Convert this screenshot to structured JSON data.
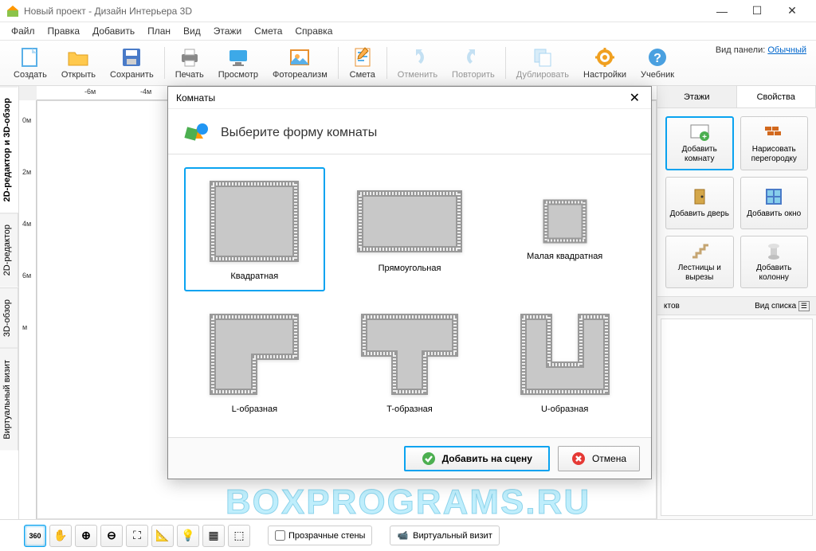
{
  "window": {
    "title": "Новый проект - Дизайн Интерьера 3D"
  },
  "menu": [
    "Файл",
    "Правка",
    "Добавить",
    "План",
    "Вид",
    "Этажи",
    "Смета",
    "Справка"
  ],
  "toolbar": {
    "create": "Создать",
    "open": "Открыть",
    "save": "Сохранить",
    "print": "Печать",
    "preview": "Просмотр",
    "photoreal": "Фотореализм",
    "estimate": "Смета",
    "undo": "Отменить",
    "redo": "Повторить",
    "duplicate": "Дублировать",
    "settings": "Настройки",
    "tutorial": "Учебник"
  },
  "panelmode": {
    "label": "Вид панели:",
    "value": "Обычный"
  },
  "lefttabs": {
    "combined": "2D-редактор и 3D-обзор",
    "editor2d": "2D-редактор",
    "view3d": "3D-обзор",
    "virtual": "Виртуальный визит"
  },
  "ruler": {
    "h": [
      "-6м",
      "-4м"
    ],
    "v": [
      "0м",
      "2м",
      "4м",
      "6м",
      "м"
    ]
  },
  "rightpanel": {
    "tabs": {
      "floors": "Этажи",
      "props": "Свойства"
    },
    "buttons": {
      "addroom": "Добавить комнату",
      "drawwall": "Нарисовать перегородку",
      "adddoor": "Добавить дверь",
      "addwindow": "Добавить окно",
      "stairs": "Лестницы и вырезы",
      "column": "Добавить колонну"
    },
    "listhdr_suffix": "ктов",
    "listview": "Вид списка"
  },
  "bottom": {
    "transparent": "Прозрачные стены",
    "virtual": "Виртуальный визит"
  },
  "modal": {
    "header": "Комнаты",
    "title": "Выберите форму комнаты",
    "shapes": {
      "square": "Квадратная",
      "rect": "Прямоугольная",
      "smallsq": "Малая квадратная",
      "l": "L-образная",
      "t": "T-образная",
      "u": "U-образная"
    },
    "add": "Добавить на сцену",
    "cancel": "Отмена"
  },
  "watermark": "BOXPROGRAMS.RU"
}
